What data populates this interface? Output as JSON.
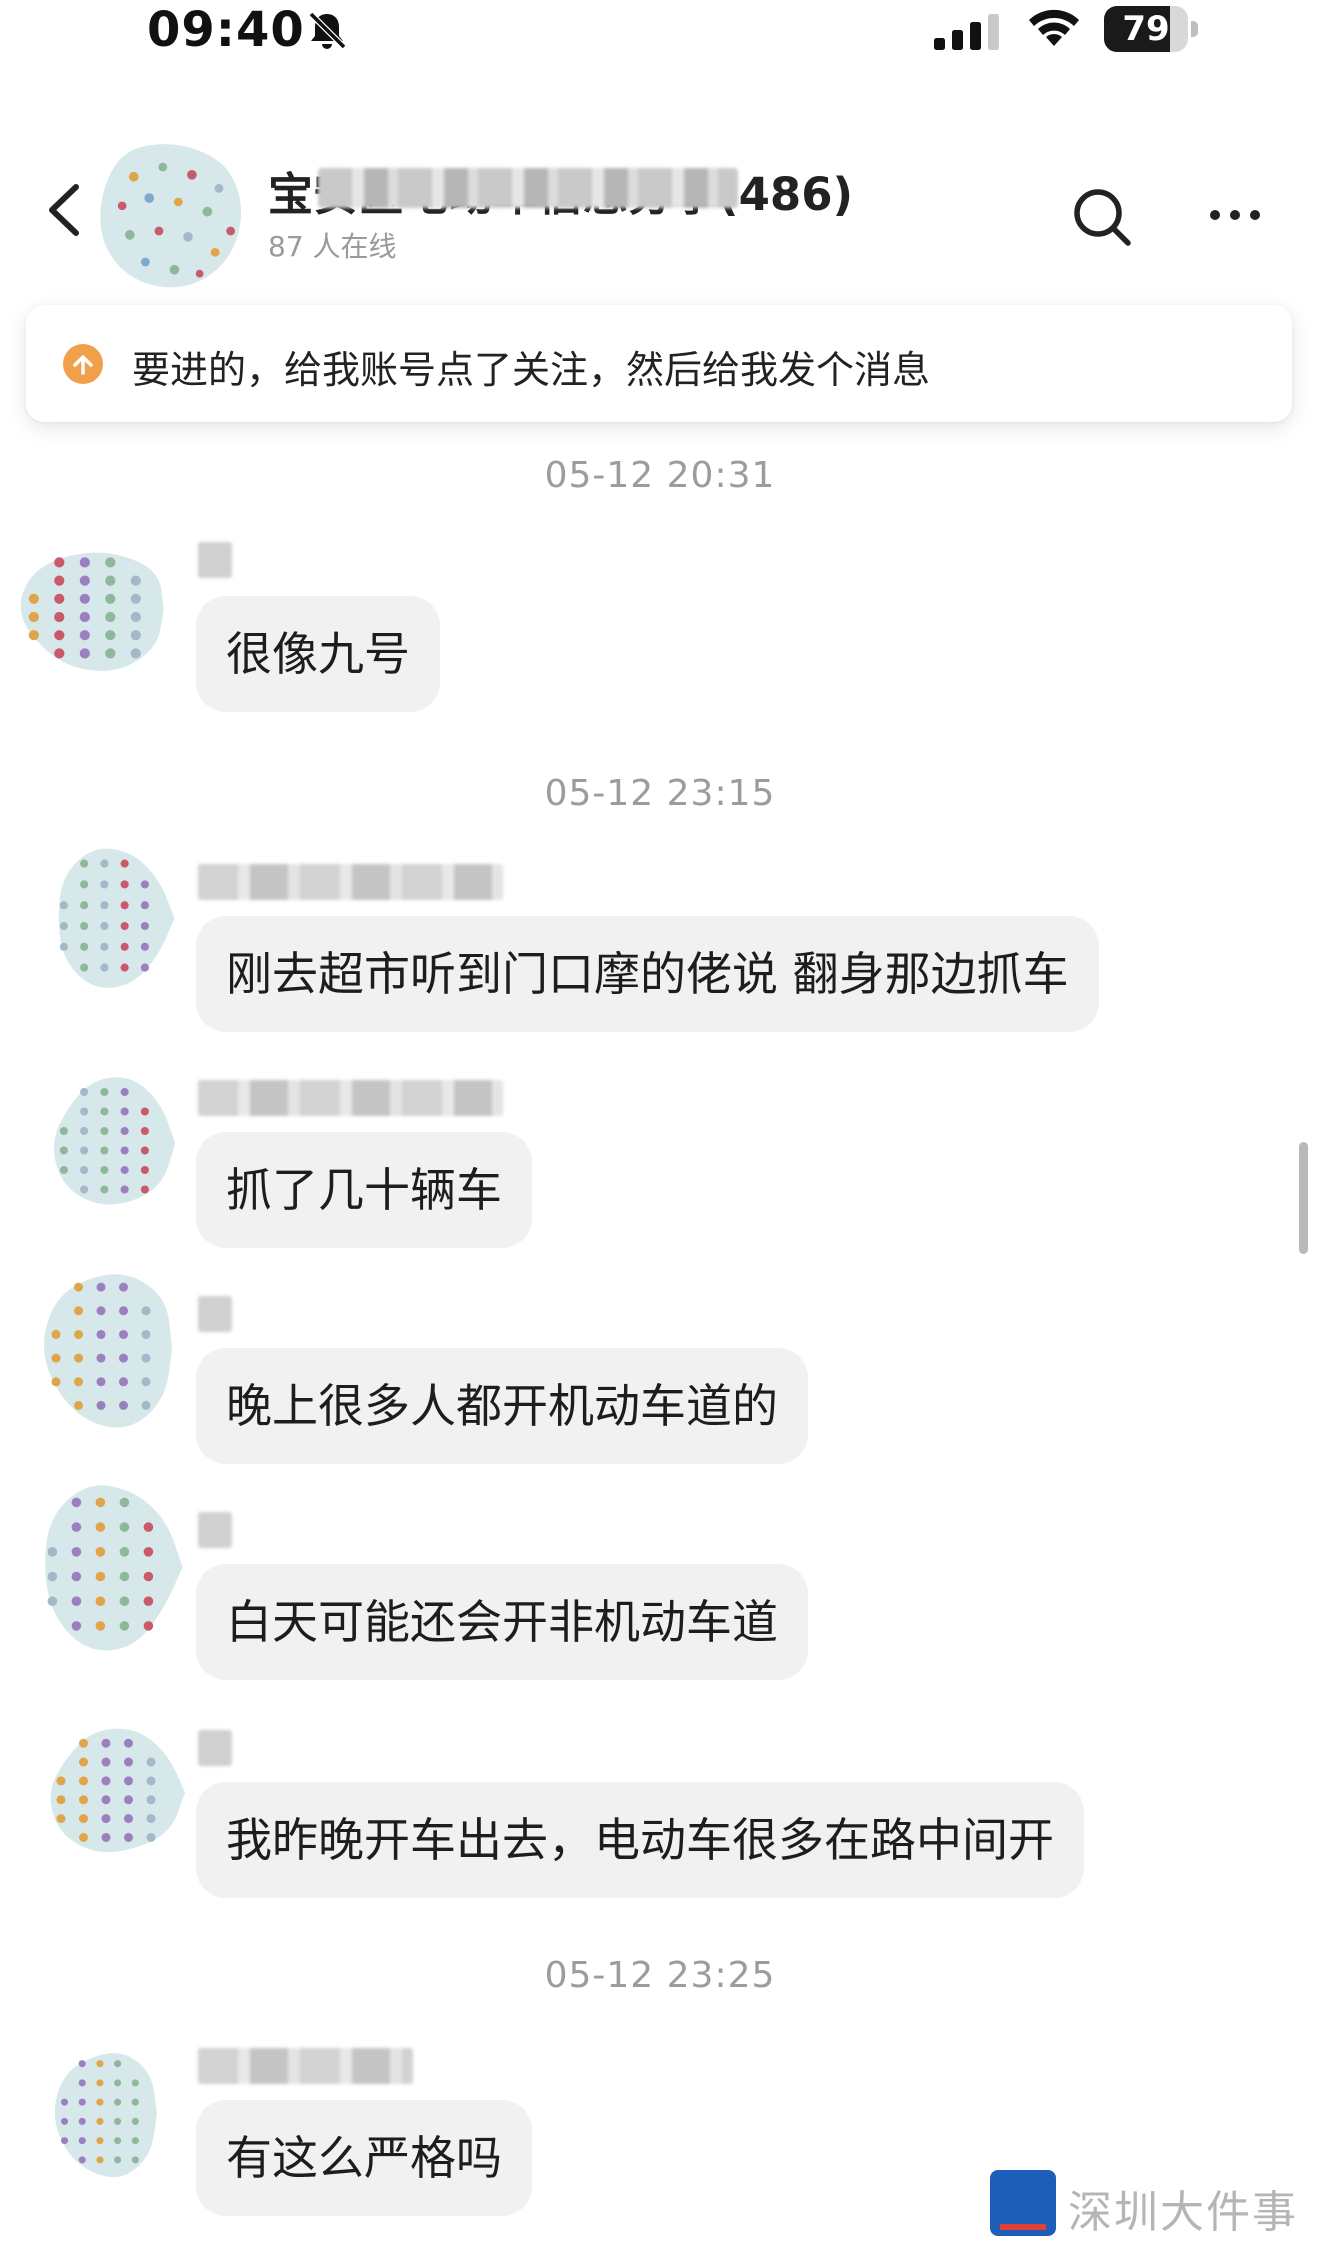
{
  "status_bar": {
    "time": "09:40",
    "battery": "79",
    "battery_fraction": 0.79
  },
  "header": {
    "title": "宝安区电动车信息分享(486)",
    "online": "87 人在线"
  },
  "pinned": {
    "text": "要进的，给我账号点了关注，然后给我发个消息"
  },
  "timestamps": [
    "05-12 20:31",
    "05-12 23:15",
    "05-12 23:25"
  ],
  "messages": [
    {
      "text": "很像九号"
    },
    {
      "text": "刚去超市听到门口摩的佬说 翻身那边抓车"
    },
    {
      "text": "抓了几十辆车"
    },
    {
      "text": "晚上很多人都开机动车道的"
    },
    {
      "text": "白天可能还会开非机动车道"
    },
    {
      "text": "我昨晚开车出去，电动车很多在路中间开"
    },
    {
      "text": "有这么严格吗"
    }
  ],
  "watermark": {
    "logo_text": "深圳 大件事",
    "text": "深圳大件事"
  },
  "colors": {
    "bubble": "#f1f1f1",
    "pin_accent": "#f0a04b",
    "timestamp": "#9c9c9c",
    "watermark_blue": "#1d5fb8"
  }
}
